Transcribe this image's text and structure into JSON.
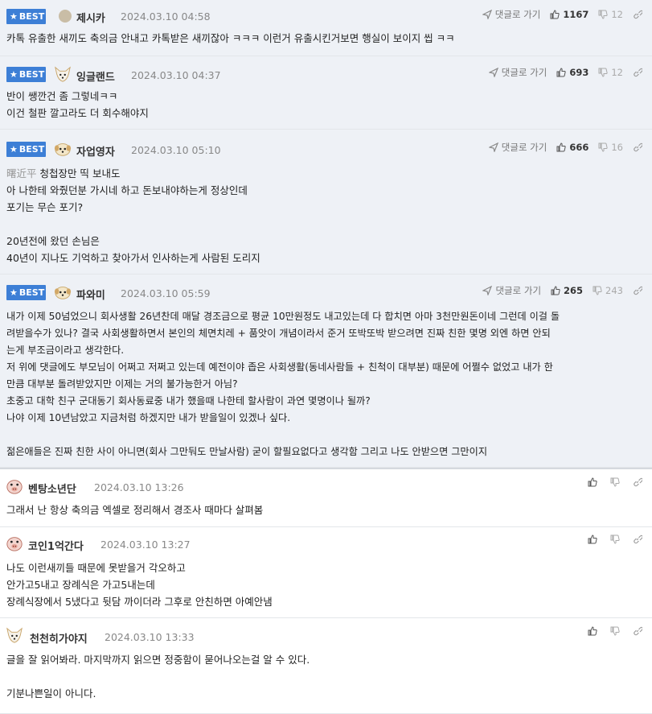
{
  "labels": {
    "best": "BEST",
    "reply": "댓글로 가기"
  },
  "colors": {
    "accent": "#3d7fd6",
    "best_bg": "#eef1f6"
  },
  "comments": [
    {
      "best": true,
      "avatar": "round-avatar",
      "nick": "제시카",
      "date": "2024.03.10 04:58",
      "up": "1167",
      "down": "12",
      "lines": [
        "카톡 유출한 새끼도 축의금 안내고 카톡받은 새끼잖아 ㅋㅋㅋ 이런거 유출시킨거보면 행실이 보이지 씹 ㅋㅋ"
      ]
    },
    {
      "best": true,
      "avatar": "fox-avatar",
      "nick": "잉글랜드",
      "date": "2024.03.10 04:37",
      "up": "693",
      "down": "12",
      "lines": [
        "반이 쌩깐건 좀 그렇네ㅋㅋ",
        "이건 철판 깔고라도 더 회수해야지"
      ]
    },
    {
      "best": true,
      "avatar": "puppy-avatar",
      "nick": "자업영자",
      "date": "2024.03.10 05:10",
      "up": "666",
      "down": "16",
      "tag": "曙近平",
      "lines": [
        "청첩장만 띡 보내도",
        "아 나한테 와줬던분 가시네 하고 돈보내야하는게 정상인데",
        "포기는 무슨 포기?",
        "",
        "20년전에 왔던 손님은",
        "40년이 지나도 기억하고 찾아가서 인사하는게 사람된 도리지"
      ]
    },
    {
      "best": true,
      "avatar": "puppy-avatar",
      "nick": "파와미",
      "date": "2024.03.10 05:59",
      "up": "265",
      "down": "243",
      "lines": [
        "내가 이제 50넘었으니 회사생활 26년찬데 매달 경조금으로 평균 10만원정도 내고있는데 다 합치면 아마 3천만원돈이네 그런데 이걸 돌",
        "려받을수가 있나? 결국 사회생활하면서 본인의 체면치레 + 품앗이 개념이라서 준거 또박또박 받으려면 진짜 친한 몇명 외엔 하면 안되",
        "는게 부조금이라고 생각한다.",
        "저 위에 댓글에도 부모님이 어쩌고 저쩌고 있는데 예전이야 좁은 사회생활(동네사람들 + 친척이 대부분) 때문에 어쩔수 없었고 내가 한",
        "만큼 대부분 돌려받았지만 이제는 거의 불가능한거 아님?",
        "초중고 대학 친구 군대동기 회사동료중 내가 했을때 나한테 할사람이 과연 몇명이나 될까?",
        "나야 이제 10년남았고 지금처럼 하겠지만 내가 받을일이 있겠나 싶다.",
        "",
        "젊은애들은 진짜 친한 사이 아니면(회사 그만둬도 만날사람) 굳이 할필요없다고 생각함 그리고 나도 안받으면 그만이지"
      ]
    },
    {
      "best": false,
      "avatar": "pig-avatar",
      "nick": "벤탕소년단",
      "date": "2024.03.10 13:26",
      "up": "",
      "down": "",
      "lines": [
        "그래서 난 항상 축의금 엑셀로 정리해서 경조사 때마다 살펴봄"
      ]
    },
    {
      "best": false,
      "avatar": "pig-avatar",
      "nick": "코인1억간다",
      "date": "2024.03.10 13:27",
      "up": "",
      "down": "",
      "lines": [
        "나도 이런새끼들 때문에 못받을거 각오하고",
        "안가고5내고 장례식은 가고5내는데",
        "장례식장에서 5냈다고 뒷담 까이더라 그후로 안친하면 아예안냄"
      ]
    },
    {
      "best": false,
      "avatar": "fox-avatar",
      "nick": "천천히가야지",
      "date": "2024.03.10 13:33",
      "up": "",
      "down": "",
      "lines": [
        "글을 잘 읽어봐라. 마지막까지 읽으면 정중함이 묻어나오는걸 알 수 있다.",
        "",
        "기분나쁜일이 아니다."
      ]
    }
  ]
}
